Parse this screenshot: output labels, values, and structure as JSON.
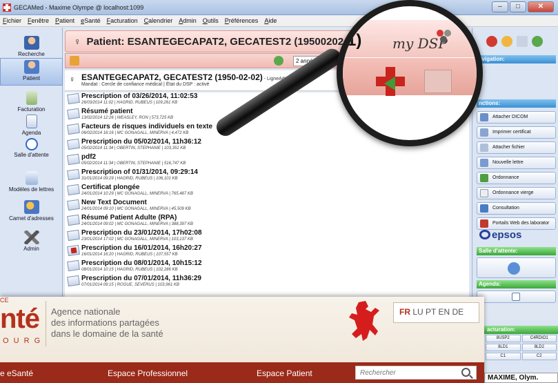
{
  "window": {
    "title": "GECAMed - Maxime Olympe @ localhost:1099"
  },
  "menu": [
    "Fichier",
    "Fenêtre",
    "Patient",
    "eSanté",
    "Facturation",
    "Calendrier",
    "Admin",
    "Outils",
    "Préférences",
    "Aide"
  ],
  "sidebar": [
    "Recherche",
    "Patient",
    "Facturation",
    "Agenda",
    "Salle d'attente",
    "Modèles de lettres",
    "Carnet d'adresses",
    "Admin"
  ],
  "patient": {
    "header": "Patient:  ESANTEGECAPAT2, GECATEST2 (19500202 0",
    "record_name": "ESANTEGECAPAT2, GECATEST2 (1950-02-02)",
    "address": " - LigneAdresse1011 Li",
    "mandate": "Mandat : Cercle de confiance médical | État du DSP : activé"
  },
  "toolbar": {
    "period": "2 années"
  },
  "documents": [
    {
      "title": "Prescription of 03/26/2014, 11:02:53",
      "meta": "26/03/2014 11:02 | HAGRID, RUBEUS | 109,261 KB"
    },
    {
      "title": "Résumé patient",
      "meta": "13/02/2014 12:26 | WEASLEY, RON | 573,725 KB"
    },
    {
      "title": "Facteurs de risques individuels en texte",
      "meta": "06/02/2014 16:16 | MC GONAGALL, MINERVA | 4,472 KB"
    },
    {
      "title": "Prescription du 05/02/2014, 11h36:12",
      "meta": "05/02/2014 11:34 | OBERTIN, STEPHANIE | 103,351 KB"
    },
    {
      "title": "pdf2",
      "meta": "05/02/2014 11:34 | OBERTIN, STEPHANIE | 516,747 KB"
    },
    {
      "title": "Prescription of 01/31/2014, 09:29:14",
      "meta": "31/01/2014 09:29 | HAGRID, RUBEUS | 106,101 KB"
    },
    {
      "title": "Certificat plongée",
      "meta": "24/01/2014 10:29 | MC GONAGALL, MINERVA | 765,487 KB"
    },
    {
      "title": "New Text Document",
      "meta": "24/01/2014 09:10 | MC GONAGALL, MINERVA | 45,509 KB"
    },
    {
      "title": "Résumé Patient Adulte (RPA)",
      "meta": "24/01/2014 09:02 | MC GONAGALL, MINERVA | 388,397 KB"
    },
    {
      "title": "Prescription du 23/01/2014, 17h02:08",
      "meta": "23/01/2014 17:02 | MC GONAGALL, MINERVA | 103,137 KB"
    },
    {
      "title": "Prescription du 16/01/2014, 16h20:27",
      "meta": "16/01/2014 16:20 | HAGRID, RUBEUS | 107,557 KB"
    },
    {
      "title": "Prescription du 08/01/2014, 10h15:12",
      "meta": "08/01/2014 10:15 | HAGRID, RUBEUS | 102,286 KB"
    },
    {
      "title": "Prescription du 07/01/2014, 11h36:29",
      "meta": "07/01/2014 09:15 | ROGUE, SEVERUS | 103,961 KB"
    }
  ],
  "right_panel": {
    "navigation": "avigation:",
    "functions": "nctions:",
    "buttons": [
      "Attacher DICOM",
      "Imprimer certificat",
      "Attacher fichier",
      "Nouvelle lettre",
      "Ordonnance",
      "Ordonnance vierge",
      "Consultation",
      "Portails Web des laborator"
    ],
    "epsos": "epsos",
    "waiting": "Salle d'attente:",
    "agenda": "Agenda:",
    "facturation": "acturation:",
    "billing_codes": [
      "8USP2",
      "C4RDIO1",
      "8LD1",
      "8LD2",
      "C1",
      "C2"
    ],
    "user": "MAXIME, Olym."
  },
  "magnifier": {
    "number": "1)",
    "logo": "my DSP"
  },
  "website": {
    "logo_top": "CE",
    "logo": "nté",
    "logo_bottom": "O U R G",
    "agency": [
      "Agence nationale",
      "des informations partagées",
      "dans le domaine de la santé"
    ],
    "languages": [
      "FR",
      "LU",
      "PT",
      "EN",
      "DE"
    ],
    "nav": [
      "e eSanté",
      "Espace Professionnel",
      "Espace Patient"
    ],
    "search_placeholder": "Rechercher"
  }
}
